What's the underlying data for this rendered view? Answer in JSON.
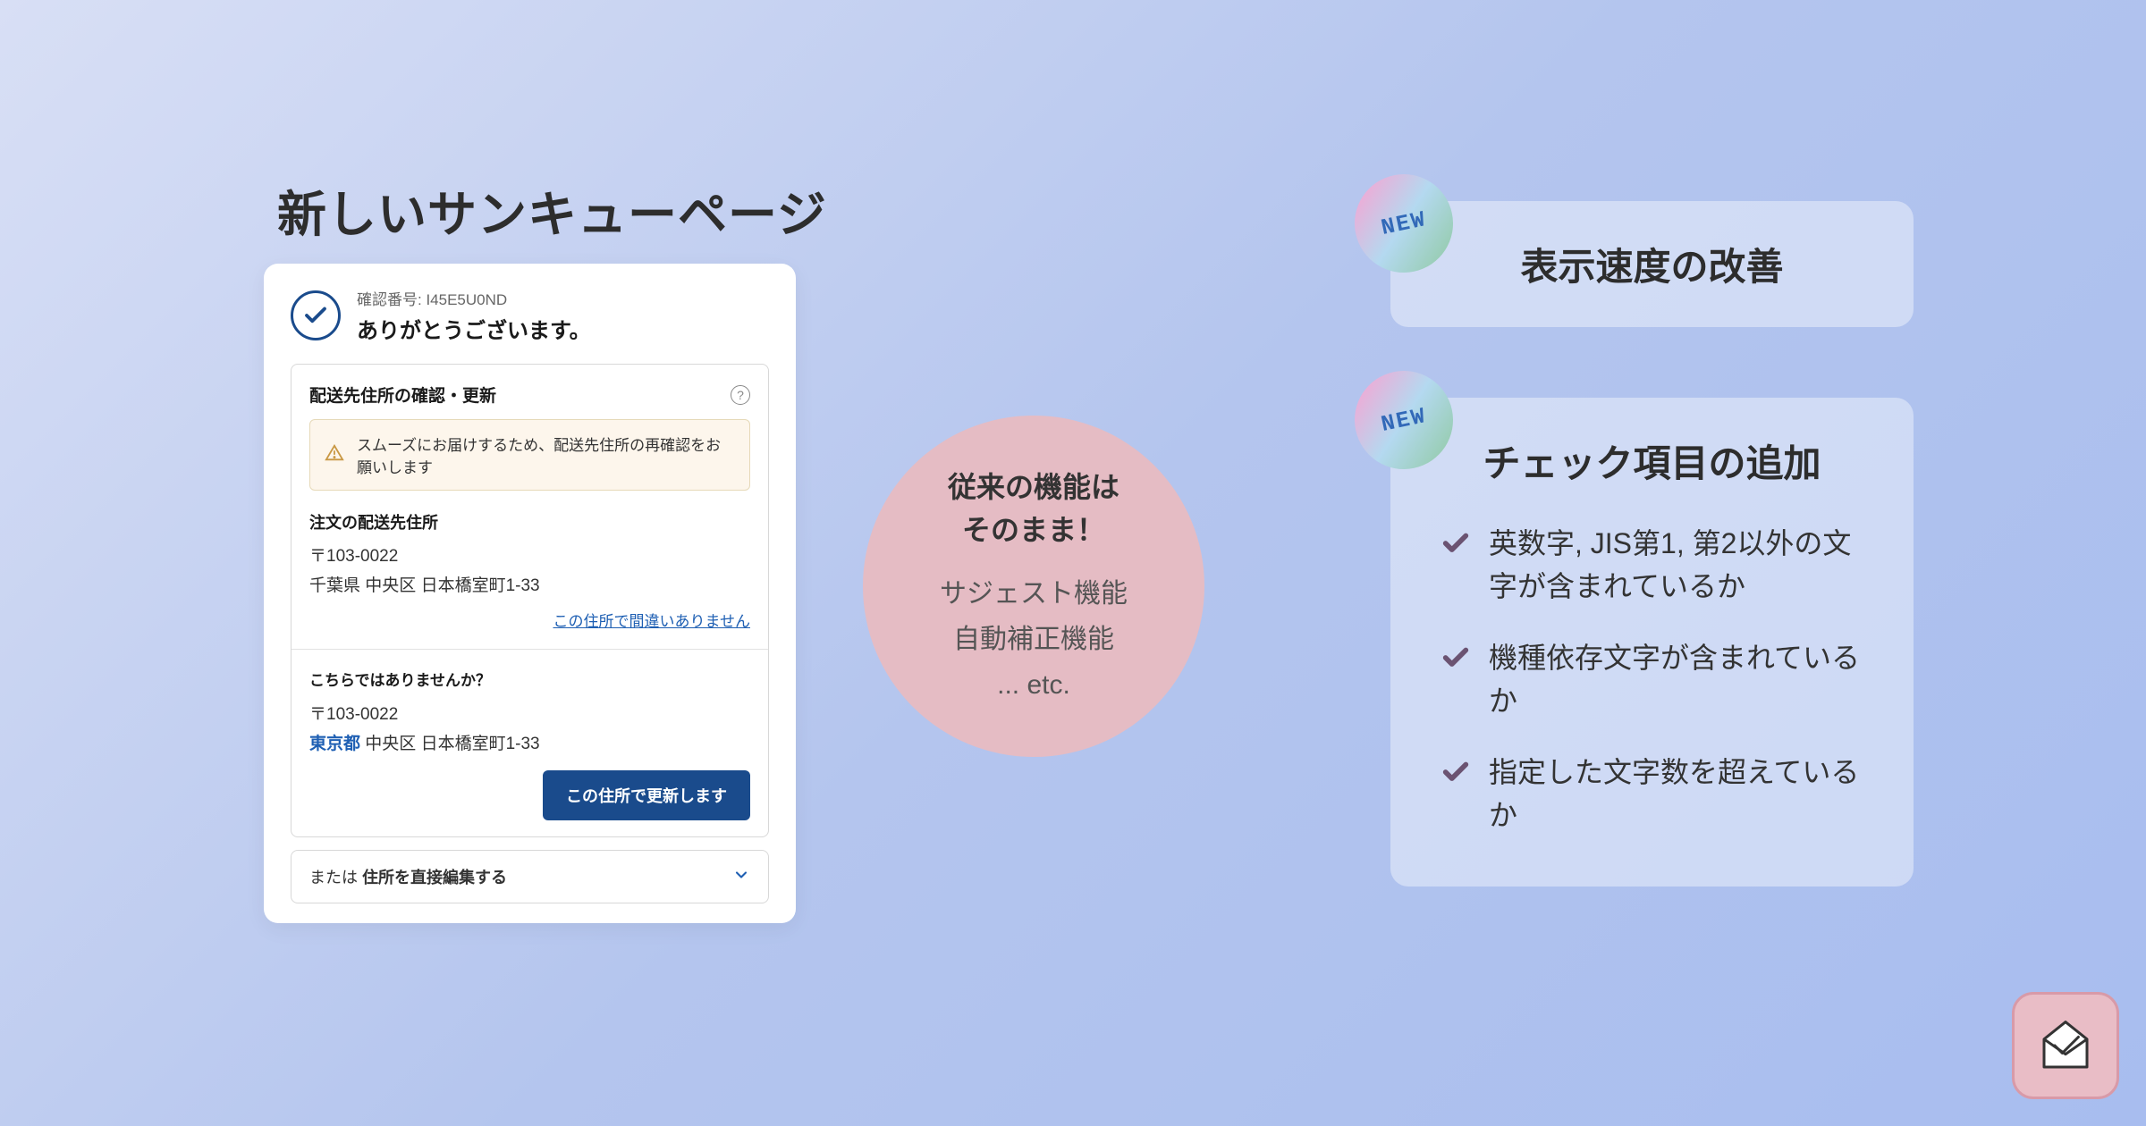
{
  "left": {
    "title": "新しいサンキューページ",
    "confirmation_prefix": "確認番号: ",
    "confirmation_number": "I45E5U0ND",
    "thank_you": "ありがとうございます。",
    "address_section": {
      "title": "配送先住所の確認・更新",
      "warning": "スムーズにお届けするため、配送先住所の再確認をお願いします",
      "order_label": "注文の配送先住所",
      "postal_symbol": "〒",
      "postal1": "103-0022",
      "address1_prefecture": "千葉県",
      "address1_rest": " 中央区  日本橋室町1-33",
      "confirm_link": "この住所で間違いありません",
      "suggestion_label": "こちらではありませんか？",
      "postal2": "103-0022",
      "address2_prefecture": "東京都",
      "address2_rest": " 中央区  日本橋室町1-33",
      "update_button": "この住所で更新します",
      "edit_prefix": "または ",
      "edit_link": "住所を直接編集する"
    }
  },
  "center": {
    "title_line1": "従来の機能は",
    "title_line2": "そのまま！",
    "item1": "サジェスト機能",
    "item2": "自動補正機能",
    "item3": "... etc."
  },
  "right": {
    "new_label": "NEW",
    "card1_title": "表示速度の改善",
    "card2_title": "チェック項目の追加",
    "checks": [
      "英数字, JIS第1, 第2以外の文字が含まれているか",
      "機種依存文字が含まれているか",
      "指定した文字数を超えているか"
    ]
  }
}
